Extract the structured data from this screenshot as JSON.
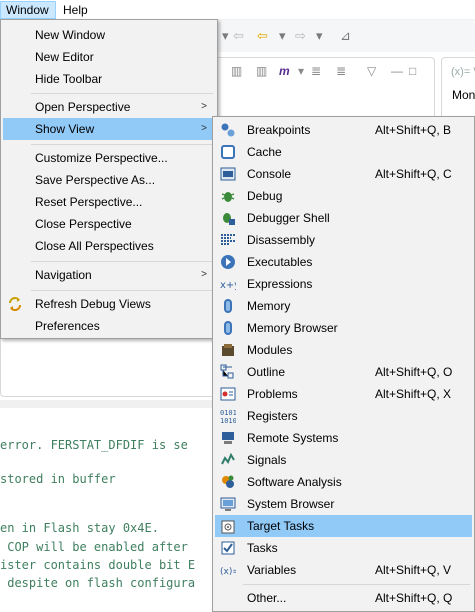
{
  "menubar": {
    "window": "Window",
    "help": "Help"
  },
  "side_panel": {
    "tab_vars": "(x)= V",
    "tab_mon": "Mon"
  },
  "code_lines": [
    "error. FERSTAT_DFDIF is se",
    "stored in buffer",
    "en in Flash stay 0x4E.",
    " COP will be enabled after",
    "ister contains double bit E",
    " despite on flash configura"
  ],
  "window_menu": {
    "new_window": "New Window",
    "new_editor": "New Editor",
    "hide_toolbar": "Hide Toolbar",
    "open_perspective": "Open Perspective",
    "show_view": "Show View",
    "customize_perspective": "Customize Perspective...",
    "save_perspective_as": "Save Perspective As...",
    "reset_perspective": "Reset Perspective...",
    "close_perspective": "Close Perspective",
    "close_all_perspectives": "Close All Perspectives",
    "navigation": "Navigation",
    "refresh_debug_views": "Refresh Debug Views",
    "preferences": "Preferences",
    "submenu_arrow": ">"
  },
  "show_view_menu": [
    {
      "label": "Breakpoints",
      "shortcut": "Alt+Shift+Q, B",
      "icon": "breakpoints-icon"
    },
    {
      "label": "Cache",
      "shortcut": "",
      "icon": "cache-icon"
    },
    {
      "label": "Console",
      "shortcut": "Alt+Shift+Q, C",
      "icon": "console-icon"
    },
    {
      "label": "Debug",
      "shortcut": "",
      "icon": "debug-icon"
    },
    {
      "label": "Debugger Shell",
      "shortcut": "",
      "icon": "debugger-shell-icon"
    },
    {
      "label": "Disassembly",
      "shortcut": "",
      "icon": "disassembly-icon"
    },
    {
      "label": "Executables",
      "shortcut": "",
      "icon": "executables-icon"
    },
    {
      "label": "Expressions",
      "shortcut": "",
      "icon": "expressions-icon"
    },
    {
      "label": "Memory",
      "shortcut": "",
      "icon": "memory-icon"
    },
    {
      "label": "Memory Browser",
      "shortcut": "",
      "icon": "memory-browser-icon"
    },
    {
      "label": "Modules",
      "shortcut": "",
      "icon": "modules-icon"
    },
    {
      "label": "Outline",
      "shortcut": "Alt+Shift+Q, O",
      "icon": "outline-icon"
    },
    {
      "label": "Problems",
      "shortcut": "Alt+Shift+Q, X",
      "icon": "problems-icon"
    },
    {
      "label": "Registers",
      "shortcut": "",
      "icon": "registers-icon"
    },
    {
      "label": "Remote Systems",
      "shortcut": "",
      "icon": "remote-systems-icon"
    },
    {
      "label": "Signals",
      "shortcut": "",
      "icon": "signals-icon"
    },
    {
      "label": "Software Analysis",
      "shortcut": "",
      "icon": "software-analysis-icon"
    },
    {
      "label": "System Browser",
      "shortcut": "",
      "icon": "system-browser-icon"
    },
    {
      "label": "Target Tasks",
      "shortcut": "",
      "icon": "target-tasks-icon"
    },
    {
      "label": "Tasks",
      "shortcut": "",
      "icon": "tasks-icon"
    },
    {
      "label": "Variables",
      "shortcut": "Alt+Shift+Q, V",
      "icon": "variables-icon"
    },
    {
      "label": "Other...",
      "shortcut": "Alt+Shift+Q, Q",
      "icon": ""
    }
  ],
  "colors": {
    "menu_bg": "#f2f2f2",
    "highlight": "#91c9f7",
    "menubar_active": "#cce8ff",
    "code_comment": "#3f7f5f"
  }
}
